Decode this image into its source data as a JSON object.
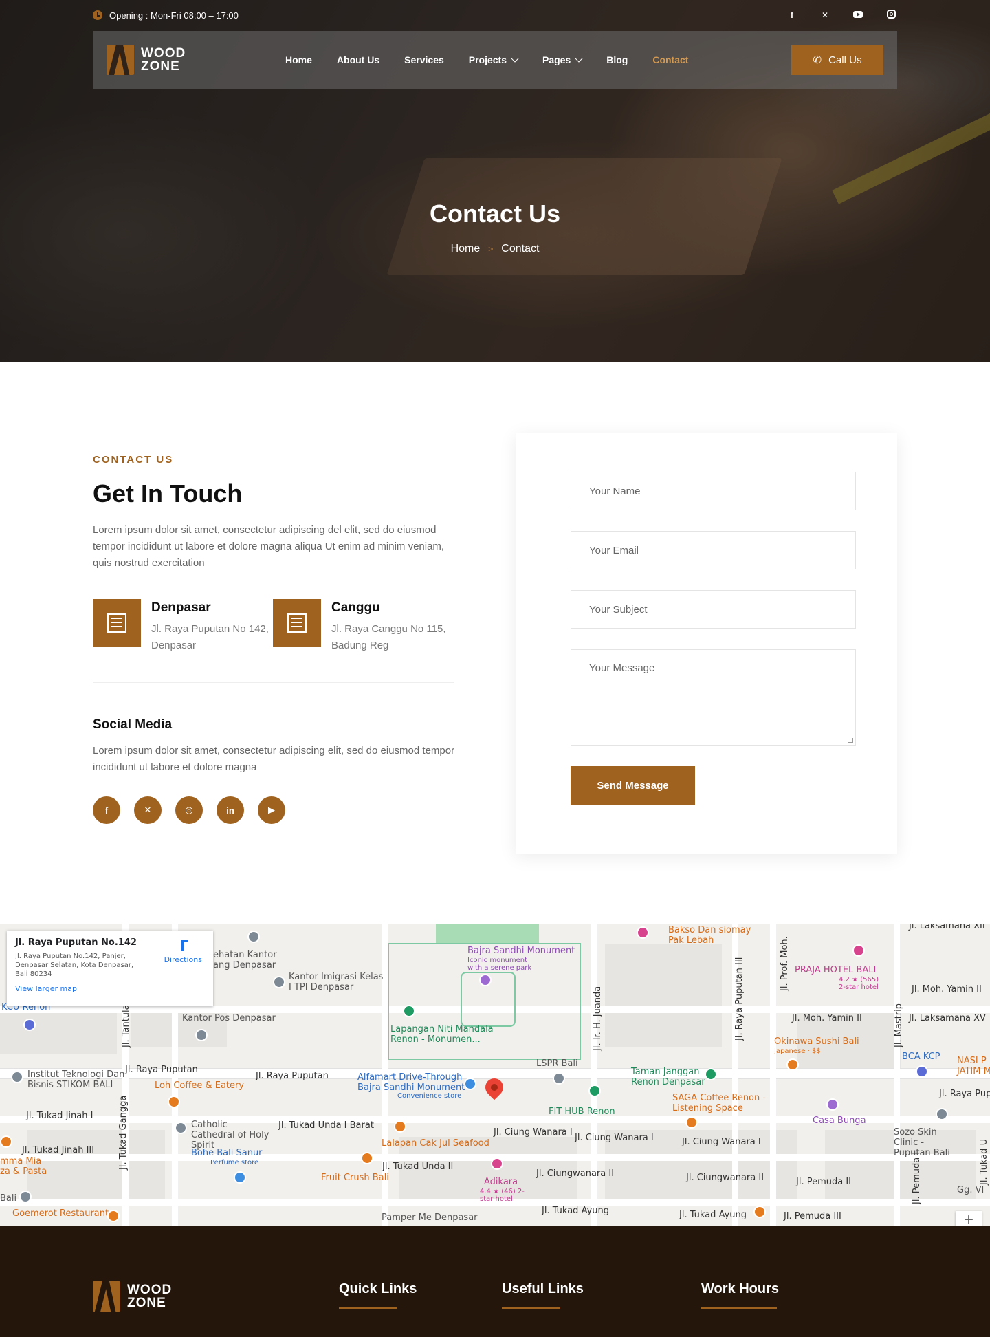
{
  "topbar": {
    "opening": "Opening : Mon-Fri 08:00 – 17:00",
    "socials": [
      "facebook-icon",
      "x-icon",
      "youtube-icon",
      "instagram-icon"
    ]
  },
  "brand": {
    "line1": "WOOD",
    "line2": "ZONE"
  },
  "nav": {
    "home": "Home",
    "about": "About Us",
    "services": "Services",
    "projects": "Projects",
    "pages": "Pages",
    "blog": "Blog",
    "contact": "Contact",
    "call": "Call Us"
  },
  "hero": {
    "title": "Contact Us",
    "crumb_home": "Home",
    "crumb_sep": ">",
    "crumb_current": "Contact"
  },
  "contact": {
    "eyebrow": "CONTACT US",
    "heading": "Get In Touch",
    "intro": "Lorem ipsum dolor sit amet, consectetur adipiscing del elit, sed do eiusmod tempor incididunt ut labore et dolore magna aliqua Ut enim ad minim veniam, quis nostrud exercitation",
    "offices": [
      {
        "name": "Denpasar",
        "address": "Jl. Raya Puputan No 142, Denpasar",
        "icon": "city-buildings-icon"
      },
      {
        "name": "Canggu",
        "address": "Jl. Raya Canggu No 115, Badung Reg",
        "icon": "office-building-icon"
      }
    ],
    "social_title": "Social Media",
    "social_text": "Lorem ipsum dolor sit amet, consectetur adipiscing elit, sed do eiusmod tempor incididunt ut labore et dolore magna",
    "social_icons": [
      "facebook-icon",
      "x-icon",
      "instagram-icon",
      "linkedin-icon",
      "youtube-icon"
    ]
  },
  "form": {
    "name_placeholder": "Your  Name",
    "email_placeholder": "Your Email",
    "subject_placeholder": "Your Subject",
    "message_placeholder": "Your Message",
    "submit": "Send Message"
  },
  "map": {
    "card_title": "Jl. Raya Puputan No.142",
    "card_address": "Jl. Raya Puputan No.142, Panjer, Denpasar Selatan, Kota Denpasar, Bali 80234",
    "directions": "Directions",
    "larger_map": "View larger map",
    "labels": {
      "bajra": "Bajra Sandhi Monument",
      "bajra_sub": "Iconic monument with a serene park",
      "lapangan": "Lapangan Niti Mandala Renon - Monumen...",
      "kantor_imigrasi": "Kantor Imigrasi Kelas I TPI Denpasar",
      "kantor_pos": "Kantor Pos Denpasar",
      "kehatan": "ehatan Kantor ang Denpasar",
      "stikom": "Institut Teknologi Dan Bisnis STIKOM BALI",
      "loh_coffee": "Loh Coffee & Eatery",
      "raya_puputan": "Jl. Raya Puputan",
      "alfamart": "Alfamart Drive-Through Bajra Sandhi Monument",
      "alfamart_sub": "Convenience store",
      "lspr": "LSPR Bali",
      "fit_hub": "FIT HUB Renon",
      "taman": "Taman Janggan Renon Denpasar",
      "saga": "SAGA Coffee Renon - Listening Space",
      "casa_bunga": "Casa Bunga",
      "sozo": "Sozo Skin Clinic - Puputan Bali",
      "praja": "PRAJA HOTEL BALI",
      "praja_sub": "4.2 ★ (565) 2-star hotel",
      "okinawa": "Okinawa Sushi Bali",
      "okinawa_sub": "Japanese · $$",
      "bca": "BCA KCP",
      "nasi": "NASI P JATIM M",
      "bakso": "Bakso Dan siomay Pak Lebah",
      "moh_yamin": "Jl. Moh. Yamin II",
      "moh_yamin_top": "Jl. Moh. Yamin II",
      "laksamana": "Jl. Laksamana XV",
      "catholic": "Catholic Cathedral of Holy Spirit",
      "bohe": "Bohe Bali Sanur",
      "bohe_sub": "Perfume store",
      "tukad_unda": "Jl. Tukad Unda I Barat",
      "lalapan": "Lalapan Cak Jul Seafood",
      "ciung_wanara": "Jl. Ciung Wanara I",
      "ciung_wanara2": "Jl. Ciung Wanara I",
      "ciung_wanara3": "Jl. Ciung Wanara I",
      "adikara": "Adikara",
      "adikara_sub": "4.4 ★ (46) 2-star hotel",
      "fruit_crush": "Fruit Crush Bali",
      "tukad_unda2": "Jl. Tukad Unda II",
      "ciungwanara_ii": "Jl. Ciungwanara II",
      "ciungwanara_ii2": "Jl. Ciungwanara II",
      "pemuda": "Jl. Pemuda II",
      "pemuda3": "Jl. Pemuda III",
      "tukad_ayung": "Jl. Tukad Ayung",
      "tukad_ayung2": "Jl. Tukad Ayung",
      "pamper": "Pamper Me Denpasar",
      "goemerot": "Goemerot Restaurant",
      "tukad_jinah": "Jl. Tukad Jinah I",
      "tukad_jinah3": "Jl. Tukad Jinah III",
      "kcu": "KCU Renon",
      "mma_mia": "mma Mia za & Pasta",
      "bali": "Bali",
      "raya_pup_right": "Jl. Raya Pup",
      "gg_vi": "Gg. VI",
      "laksamana_top": "Jl. Laksamana XII",
      "tantular": "Jl. Tantular",
      "tukad_gangga": "Jl. Tukad Gangga",
      "ir_juanda": "Jl. Ir. H. Juanda",
      "raya_puputan_iii": "Jl. Raya Puputan III",
      "prof_moh": "Jl. Prof. Moh.",
      "mastrip": "Jl. Mastrip",
      "jl_pemuda_i": "Jl. Pemuda I",
      "tukad_u": "Jl. Tukad U"
    }
  },
  "footer": {
    "quick_links": "Quick Links",
    "useful_links": "Useful Links",
    "work_hours": "Work Hours"
  }
}
